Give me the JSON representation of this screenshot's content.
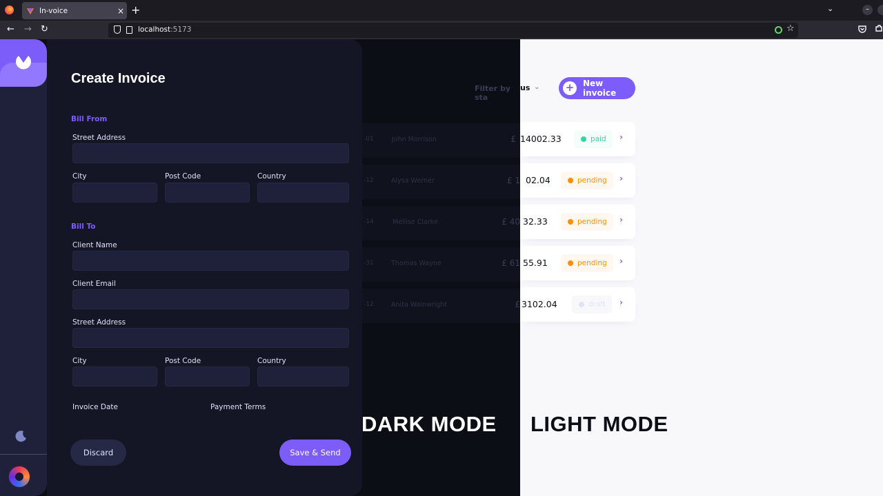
{
  "browser": {
    "tab_title": "In-voice",
    "tab_close": "×",
    "new_tab": "+",
    "url_host": "localhost",
    "url_port": ":5173",
    "back": "←",
    "forward": "→",
    "reload": "↻",
    "tab_list": "⌄",
    "bookmark": "☆",
    "minimize": "–"
  },
  "form": {
    "title": "Create Invoice",
    "bill_from": {
      "section": "Bill From",
      "street_label": "Street Address",
      "city_label": "City",
      "post_code_label": "Post Code",
      "country_label": "Country"
    },
    "bill_to": {
      "section": "Bill To",
      "client_name_label": "Client Name",
      "client_email_label": "Client Email",
      "street_label": "Street Address",
      "city_label": "City",
      "post_code_label": "Post Code",
      "country_label": "Country"
    },
    "invoice_date_label": "Invoice Date",
    "payment_terms_label": "Payment Terms",
    "discard": "Discard",
    "save_send": "Save & Send"
  },
  "dark_list": {
    "filter_fragment": "Filter by sta",
    "rows": [
      {
        "id": "-01",
        "name": "John Morrison",
        "amount": "£",
        "amount_tail": ""
      },
      {
        "id": "-12",
        "name": "Alysa Werner",
        "amount": "£ 1",
        "amount_tail": ""
      },
      {
        "id": "-14",
        "name": "Mellise Clarke",
        "amount": "£ 40",
        "amount_tail": ""
      },
      {
        "id": "-31",
        "name": "Thomas Wayne",
        "amount": "£ 61",
        "amount_tail": ""
      },
      {
        "id": "-12",
        "name": "Anita Wainwright",
        "amount": "£",
        "amount_tail": ""
      }
    ]
  },
  "light_list": {
    "filter_fragment": "us",
    "new_invoice": "New invoice",
    "new_invoice_plus": "+",
    "arrow": "›",
    "chevron": "⌄",
    "rows": [
      {
        "amount": "14002.33",
        "status": "paid"
      },
      {
        "amount": "02.04",
        "status": "pending"
      },
      {
        "amount": "32.33",
        "status": "pending"
      },
      {
        "amount": "55.91",
        "status": "pending"
      },
      {
        "amount": "3102.04",
        "status": "draft"
      }
    ]
  },
  "labels": {
    "dark_mode": "DARK MODE",
    "light_mode": "LIGHT MODE"
  },
  "colors": {
    "accent": "#7c5dfa",
    "paid": "#33d69f",
    "pending": "#ff8f00",
    "draft": "#dfe3fa",
    "dark_bg": "#141625",
    "light_bg": "#f8f8fb"
  }
}
